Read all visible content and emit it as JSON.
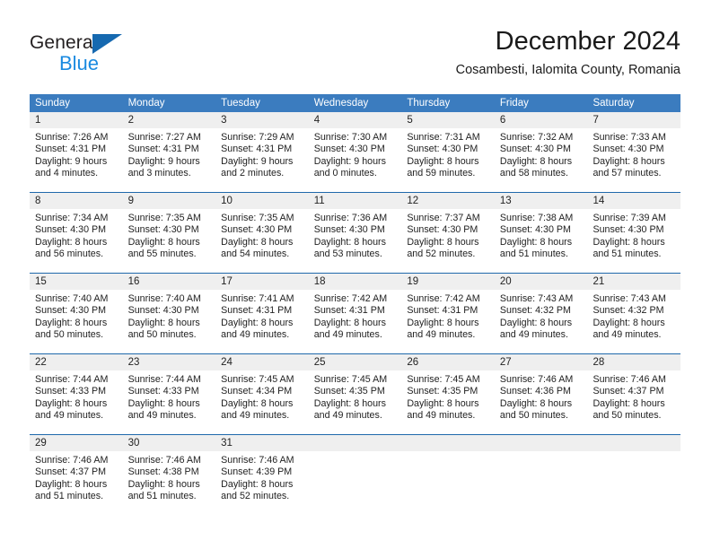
{
  "brand": {
    "name_top": "General",
    "name_bottom": "Blue",
    "triangle_color": "#1669b0",
    "bottom_color": "#1a8ae0"
  },
  "header": {
    "title": "December 2024",
    "subtitle": "Cosambesti, Ialomita County, Romania"
  },
  "theme": {
    "header_row_bg": "#3b7cbf",
    "week_separator": "#1f69ab",
    "day_number_strip_bg": "#efefef",
    "text_color": "#222222"
  },
  "weekdays": [
    "Sunday",
    "Monday",
    "Tuesday",
    "Wednesday",
    "Thursday",
    "Friday",
    "Saturday"
  ],
  "weeks": [
    [
      {
        "day": "1",
        "lines": [
          "Sunrise: 7:26 AM",
          "Sunset: 4:31 PM",
          "Daylight: 9 hours",
          "and 4 minutes."
        ]
      },
      {
        "day": "2",
        "lines": [
          "Sunrise: 7:27 AM",
          "Sunset: 4:31 PM",
          "Daylight: 9 hours",
          "and 3 minutes."
        ]
      },
      {
        "day": "3",
        "lines": [
          "Sunrise: 7:29 AM",
          "Sunset: 4:31 PM",
          "Daylight: 9 hours",
          "and 2 minutes."
        ]
      },
      {
        "day": "4",
        "lines": [
          "Sunrise: 7:30 AM",
          "Sunset: 4:30 PM",
          "Daylight: 9 hours",
          "and 0 minutes."
        ]
      },
      {
        "day": "5",
        "lines": [
          "Sunrise: 7:31 AM",
          "Sunset: 4:30 PM",
          "Daylight: 8 hours",
          "and 59 minutes."
        ]
      },
      {
        "day": "6",
        "lines": [
          "Sunrise: 7:32 AM",
          "Sunset: 4:30 PM",
          "Daylight: 8 hours",
          "and 58 minutes."
        ]
      },
      {
        "day": "7",
        "lines": [
          "Sunrise: 7:33 AM",
          "Sunset: 4:30 PM",
          "Daylight: 8 hours",
          "and 57 minutes."
        ]
      }
    ],
    [
      {
        "day": "8",
        "lines": [
          "Sunrise: 7:34 AM",
          "Sunset: 4:30 PM",
          "Daylight: 8 hours",
          "and 56 minutes."
        ]
      },
      {
        "day": "9",
        "lines": [
          "Sunrise: 7:35 AM",
          "Sunset: 4:30 PM",
          "Daylight: 8 hours",
          "and 55 minutes."
        ]
      },
      {
        "day": "10",
        "lines": [
          "Sunrise: 7:35 AM",
          "Sunset: 4:30 PM",
          "Daylight: 8 hours",
          "and 54 minutes."
        ]
      },
      {
        "day": "11",
        "lines": [
          "Sunrise: 7:36 AM",
          "Sunset: 4:30 PM",
          "Daylight: 8 hours",
          "and 53 minutes."
        ]
      },
      {
        "day": "12",
        "lines": [
          "Sunrise: 7:37 AM",
          "Sunset: 4:30 PM",
          "Daylight: 8 hours",
          "and 52 minutes."
        ]
      },
      {
        "day": "13",
        "lines": [
          "Sunrise: 7:38 AM",
          "Sunset: 4:30 PM",
          "Daylight: 8 hours",
          "and 51 minutes."
        ]
      },
      {
        "day": "14",
        "lines": [
          "Sunrise: 7:39 AM",
          "Sunset: 4:30 PM",
          "Daylight: 8 hours",
          "and 51 minutes."
        ]
      }
    ],
    [
      {
        "day": "15",
        "lines": [
          "Sunrise: 7:40 AM",
          "Sunset: 4:30 PM",
          "Daylight: 8 hours",
          "and 50 minutes."
        ]
      },
      {
        "day": "16",
        "lines": [
          "Sunrise: 7:40 AM",
          "Sunset: 4:30 PM",
          "Daylight: 8 hours",
          "and 50 minutes."
        ]
      },
      {
        "day": "17",
        "lines": [
          "Sunrise: 7:41 AM",
          "Sunset: 4:31 PM",
          "Daylight: 8 hours",
          "and 49 minutes."
        ]
      },
      {
        "day": "18",
        "lines": [
          "Sunrise: 7:42 AM",
          "Sunset: 4:31 PM",
          "Daylight: 8 hours",
          "and 49 minutes."
        ]
      },
      {
        "day": "19",
        "lines": [
          "Sunrise: 7:42 AM",
          "Sunset: 4:31 PM",
          "Daylight: 8 hours",
          "and 49 minutes."
        ]
      },
      {
        "day": "20",
        "lines": [
          "Sunrise: 7:43 AM",
          "Sunset: 4:32 PM",
          "Daylight: 8 hours",
          "and 49 minutes."
        ]
      },
      {
        "day": "21",
        "lines": [
          "Sunrise: 7:43 AM",
          "Sunset: 4:32 PM",
          "Daylight: 8 hours",
          "and 49 minutes."
        ]
      }
    ],
    [
      {
        "day": "22",
        "lines": [
          "Sunrise: 7:44 AM",
          "Sunset: 4:33 PM",
          "Daylight: 8 hours",
          "and 49 minutes."
        ]
      },
      {
        "day": "23",
        "lines": [
          "Sunrise: 7:44 AM",
          "Sunset: 4:33 PM",
          "Daylight: 8 hours",
          "and 49 minutes."
        ]
      },
      {
        "day": "24",
        "lines": [
          "Sunrise: 7:45 AM",
          "Sunset: 4:34 PM",
          "Daylight: 8 hours",
          "and 49 minutes."
        ]
      },
      {
        "day": "25",
        "lines": [
          "Sunrise: 7:45 AM",
          "Sunset: 4:35 PM",
          "Daylight: 8 hours",
          "and 49 minutes."
        ]
      },
      {
        "day": "26",
        "lines": [
          "Sunrise: 7:45 AM",
          "Sunset: 4:35 PM",
          "Daylight: 8 hours",
          "and 49 minutes."
        ]
      },
      {
        "day": "27",
        "lines": [
          "Sunrise: 7:46 AM",
          "Sunset: 4:36 PM",
          "Daylight: 8 hours",
          "and 50 minutes."
        ]
      },
      {
        "day": "28",
        "lines": [
          "Sunrise: 7:46 AM",
          "Sunset: 4:37 PM",
          "Daylight: 8 hours",
          "and 50 minutes."
        ]
      }
    ],
    [
      {
        "day": "29",
        "lines": [
          "Sunrise: 7:46 AM",
          "Sunset: 4:37 PM",
          "Daylight: 8 hours",
          "and 51 minutes."
        ]
      },
      {
        "day": "30",
        "lines": [
          "Sunrise: 7:46 AM",
          "Sunset: 4:38 PM",
          "Daylight: 8 hours",
          "and 51 minutes."
        ]
      },
      {
        "day": "31",
        "lines": [
          "Sunrise: 7:46 AM",
          "Sunset: 4:39 PM",
          "Daylight: 8 hours",
          "and 52 minutes."
        ]
      },
      {
        "day": "",
        "lines": []
      },
      {
        "day": "",
        "lines": []
      },
      {
        "day": "",
        "lines": []
      },
      {
        "day": "",
        "lines": []
      }
    ]
  ]
}
